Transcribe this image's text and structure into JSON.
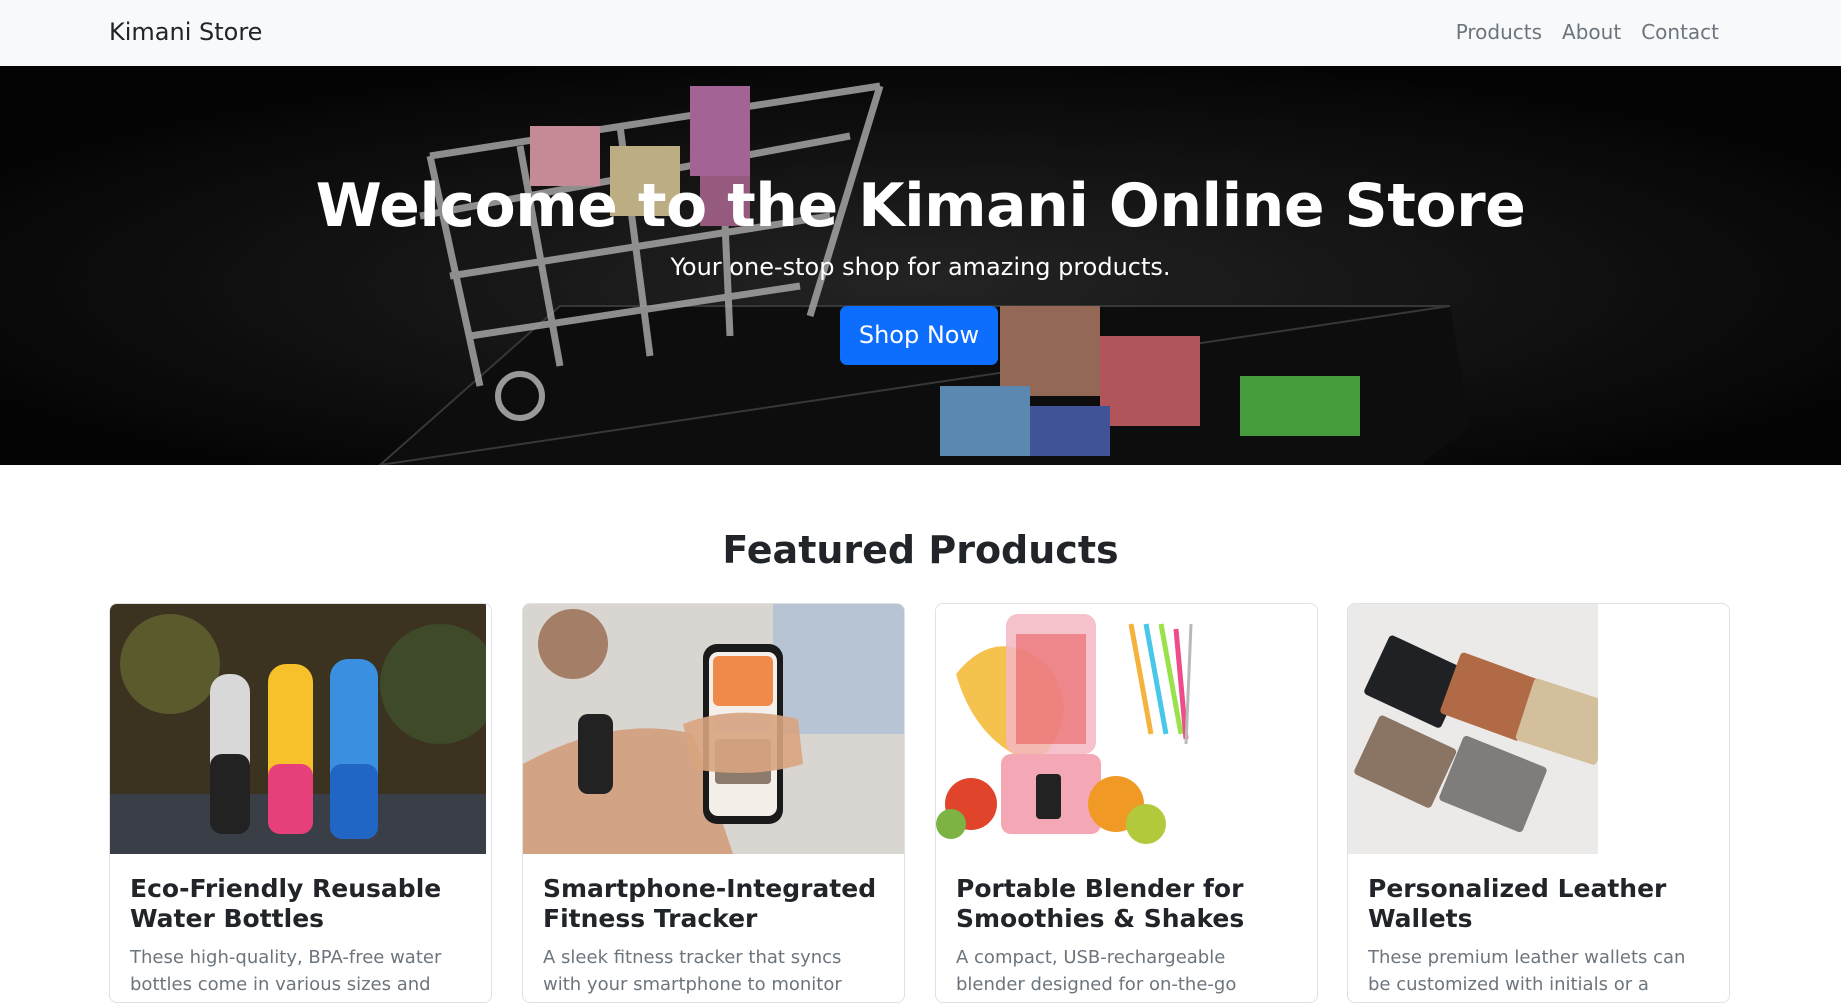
{
  "navbar": {
    "brand": "Kimani Store",
    "links": [
      {
        "label": "Products"
      },
      {
        "label": "About"
      },
      {
        "label": "Contact"
      }
    ]
  },
  "hero": {
    "title": "Welcome to the Kimani Online Store",
    "subtitle": "Your one-stop shop for amazing products.",
    "button_label": "Shop Now"
  },
  "featured": {
    "title": "Featured Products",
    "products": [
      {
        "title": "Eco-Friendly Reusable Water Bottles",
        "description": "These high-quality, BPA-free water bottles come in various sizes and colors. Made"
      },
      {
        "title": "Smartphone-Integrated Fitness Tracker",
        "description": "A sleek fitness tracker that syncs with your smartphone to monitor steps, heart rate"
      },
      {
        "title": "Portable Blender for Smoothies & Shakes",
        "description": "A compact, USB-rechargeable blender designed for on-the-go smoothies, shakes"
      },
      {
        "title": "Personalized Leather Wallets",
        "description": "These premium leather wallets can be customized with initials or a name, making them a thoughtful gift for any occasion."
      }
    ]
  },
  "colors": {
    "primary": "#0d6efd",
    "navbar_bg": "#f8f9fa",
    "muted_text": "#6c757d"
  }
}
